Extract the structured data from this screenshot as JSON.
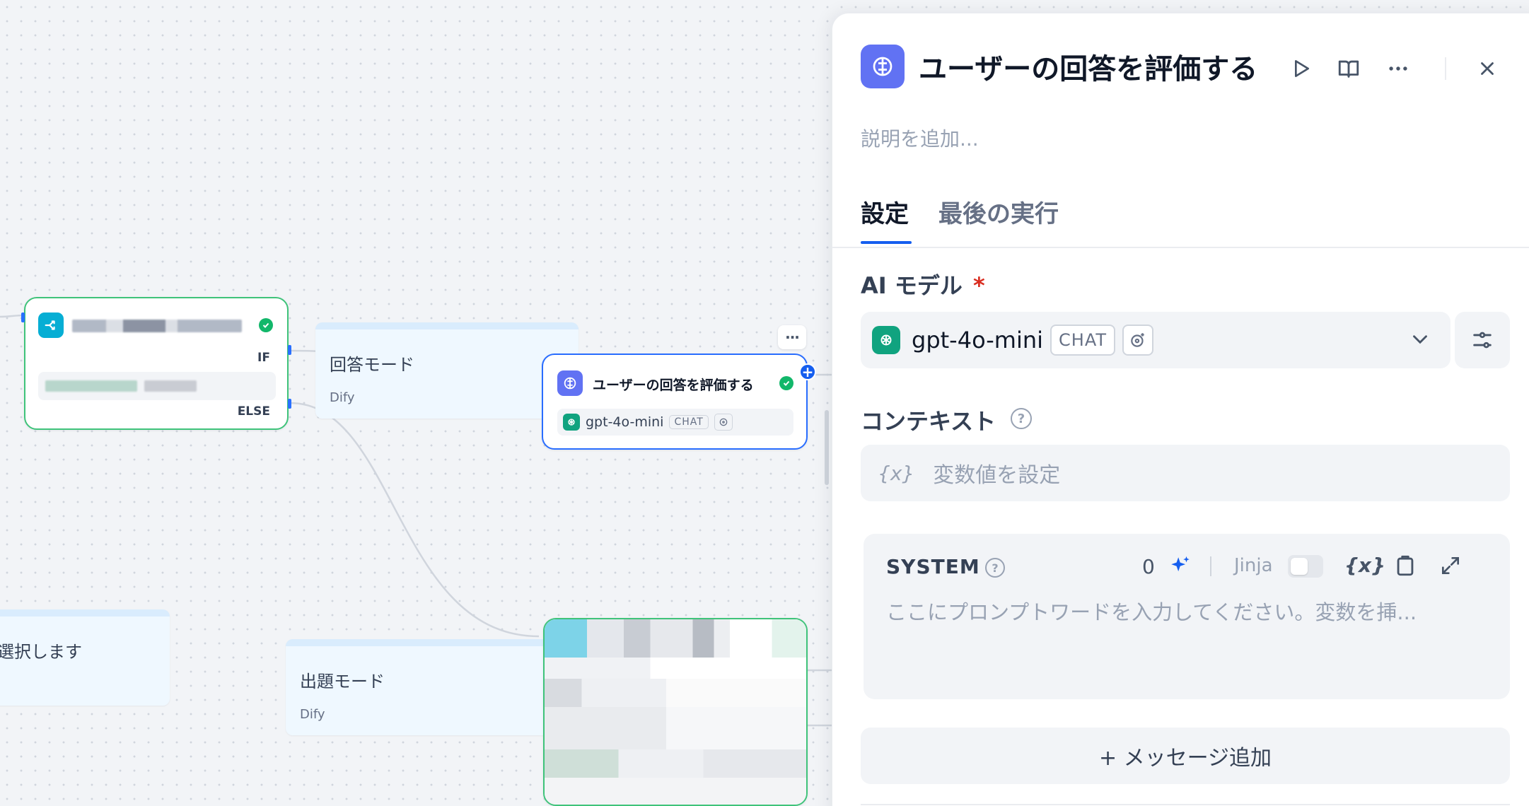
{
  "canvas": {
    "if_else_node": {
      "if_label": "IF",
      "else_label": "ELSE"
    },
    "note_answer_mode": {
      "title": "回答モード",
      "sub": "Dify"
    },
    "note_question_mode": {
      "title": "出題モード",
      "sub": "Dify"
    },
    "note_select": {
      "title": "選択します"
    },
    "llm_node": {
      "title": "ユーザーの回答を評価する",
      "model": "gpt-4o-mini",
      "badge": "CHAT"
    },
    "more_dots": "···"
  },
  "panel": {
    "title": "ユーザーの回答を評価する",
    "description_placeholder": "説明を追加...",
    "tabs": [
      {
        "label": "設定",
        "active": true
      },
      {
        "label": "最後の実行",
        "active": false
      }
    ],
    "model_section": {
      "label": "AI モデル",
      "required_mark": "*",
      "model_name": "gpt-4o-mini",
      "badge": "CHAT"
    },
    "context_section": {
      "label": "コンテキスト",
      "var_glyph": "{x}",
      "placeholder": "変数値を設定"
    },
    "system_prompt": {
      "label": "SYSTEM",
      "count": "0",
      "jinja_label": "Jinja",
      "var_glyph": "{x}",
      "placeholder": "ここにプロンプトワードを入力してください。変数を挿..."
    },
    "add_message": "+ メッセージ追加"
  },
  "colors": {
    "accent_blue": "#155eef",
    "llm_purple": "#6172f3",
    "openai_green": "#10a37f",
    "if_else_cyan": "#06aed4",
    "success_green": "#12b76a",
    "required_red": "#d92d20"
  }
}
